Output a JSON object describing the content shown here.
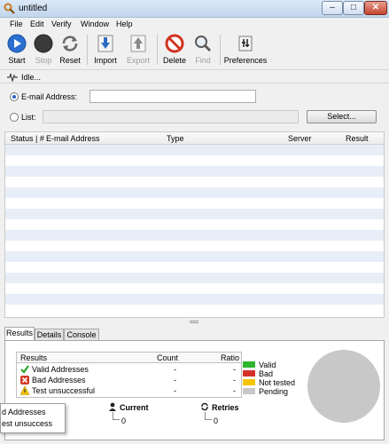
{
  "window": {
    "title": "untitled"
  },
  "menu": [
    "File",
    "Edit",
    "Verify",
    "Window",
    "Help"
  ],
  "toolbar": {
    "start": "Start",
    "stop": "Stop",
    "reset": "Reset",
    "import": "Import",
    "export": "Export",
    "delete": "Delete",
    "find": "Find",
    "preferences": "Preferences"
  },
  "status_text": "Idle...",
  "input": {
    "email_label": "E-mail Address:",
    "email_value": "",
    "list_label": "List:",
    "list_value": "",
    "select_button": "Select..."
  },
  "grid": {
    "columns": [
      "Status | #",
      "E-mail Address",
      "Type",
      "Server",
      "Result"
    ]
  },
  "tabs": [
    "Results",
    "Details",
    "Console"
  ],
  "results": {
    "headers": [
      "Results",
      "Count",
      "Ratio"
    ],
    "rows": [
      {
        "label": "Valid Addresses",
        "count": "-",
        "ratio": "-"
      },
      {
        "label": "Bad Addresses",
        "count": "-",
        "ratio": "-"
      },
      {
        "label": "Test unsuccessful",
        "count": "-",
        "ratio": "-"
      }
    ]
  },
  "legend": [
    {
      "label": "Valid",
      "color": "#2db52d"
    },
    {
      "label": "Bad",
      "color": "#d4302a"
    },
    {
      "label": "Not tested",
      "color": "#f5c400"
    },
    {
      "label": "Pending",
      "color": "#c8c8c8"
    }
  ],
  "stats": {
    "current_label": "Current",
    "current_value": "0",
    "retries_label": "Retries",
    "retries_value": "0"
  },
  "tooltip": {
    "line1": "d Addresses",
    "line2": "est unsuccess"
  }
}
